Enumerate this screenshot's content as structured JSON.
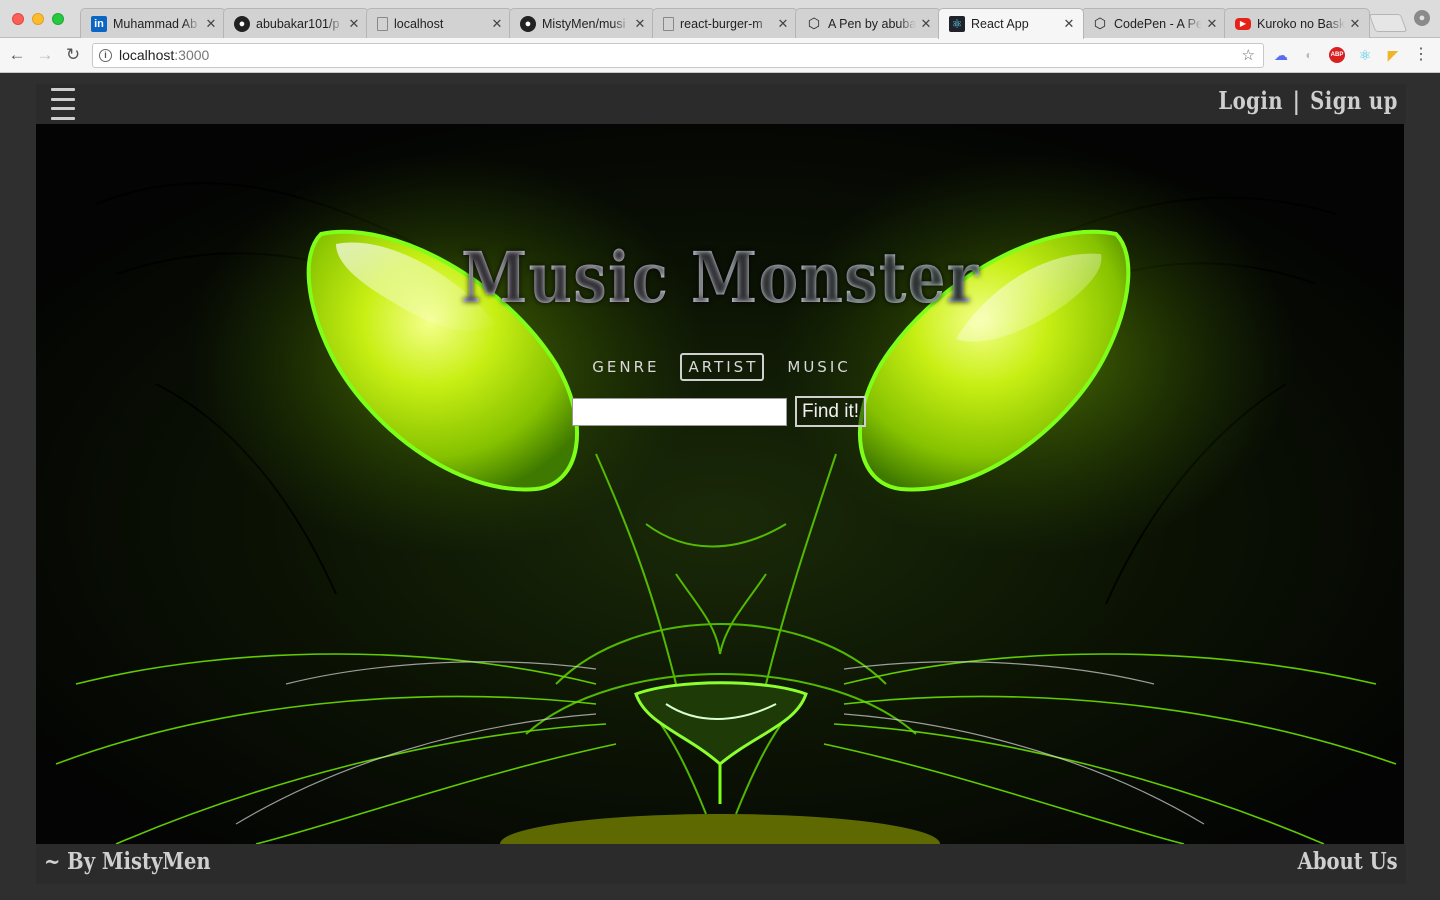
{
  "browser": {
    "tabs": [
      {
        "title": "Muhammad Ab",
        "favicon": "linkedin-icon",
        "active": false
      },
      {
        "title": "abubakar101/p",
        "favicon": "github-icon",
        "active": false
      },
      {
        "title": "localhost",
        "favicon": "page-icon",
        "active": false
      },
      {
        "title": "MistyMen/musi",
        "favicon": "github-icon",
        "active": false
      },
      {
        "title": "react-burger-m",
        "favicon": "page-icon",
        "active": false
      },
      {
        "title": "A Pen by abuba",
        "favicon": "codepen-icon",
        "active": false
      },
      {
        "title": "React App",
        "favicon": "react-icon",
        "active": true
      },
      {
        "title": "CodePen - A Pe",
        "favicon": "codepen-icon",
        "active": false
      },
      {
        "title": "Kuroko no Bask",
        "favicon": "youtube-icon",
        "active": false
      }
    ],
    "address": {
      "host": "localhost",
      "port": ":3000"
    }
  },
  "header": {
    "login_label": "Login",
    "separator": "|",
    "signup_label": "Sign up"
  },
  "hero": {
    "title": "Music Monster",
    "modes": [
      {
        "label": "GENRE",
        "active": false
      },
      {
        "label": "ARTIST",
        "active": true
      },
      {
        "label": "MUSIC",
        "active": false
      }
    ],
    "search": {
      "value": "",
      "placeholder": ""
    },
    "find_label": "Find it!"
  },
  "footer": {
    "by_label": "~ By MistyMen",
    "about_label": "About Us"
  },
  "colors": {
    "eye_green": "#a8e000",
    "panel_dark": "#2b2b2b",
    "text_light": "#cfcfcf"
  }
}
